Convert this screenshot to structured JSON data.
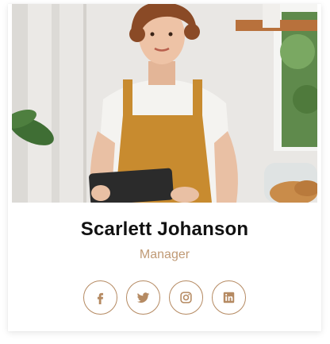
{
  "profile": {
    "name": "Scarlett Johanson",
    "role": "Manager"
  },
  "social_links": [
    {
      "icon": "facebook-icon"
    },
    {
      "icon": "twitter-icon"
    },
    {
      "icon": "instagram-icon"
    },
    {
      "icon": "linkedin-icon"
    }
  ],
  "colors": {
    "accent": "#b58a62",
    "role_text": "#c09a75",
    "name_text": "#111111"
  }
}
